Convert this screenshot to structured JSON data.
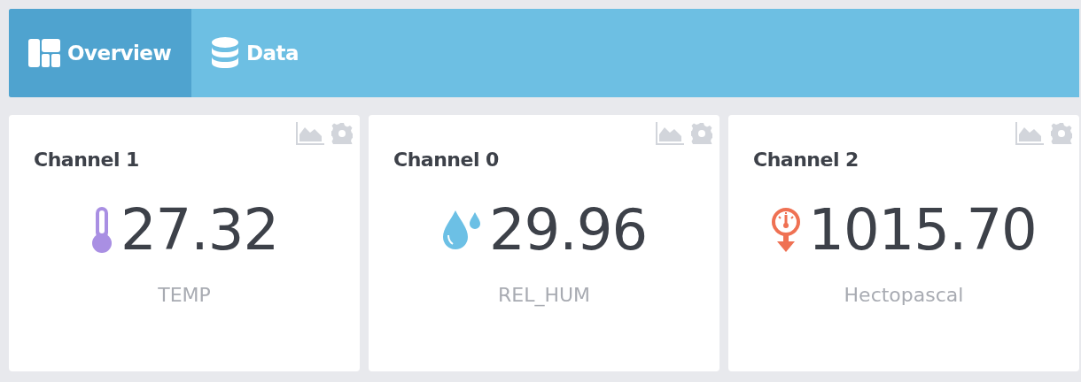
{
  "tabs": [
    {
      "label": "Overview",
      "kind": "overview",
      "selected": true
    },
    {
      "label": "Data",
      "kind": "data",
      "selected": false
    }
  ],
  "widgets": [
    {
      "title": "Channel 1",
      "kind": "thermometer",
      "color": "#a98fe3",
      "value": "27.32",
      "unit": "TEMP"
    },
    {
      "title": "Channel 0",
      "kind": "drop",
      "color": "#6cc0e5",
      "value": "29.96",
      "unit": "REL_HUM"
    },
    {
      "title": "Channel 2",
      "kind": "barometer",
      "color": "#ef7153",
      "value": "1015.70",
      "unit": "Hectopascal"
    }
  ]
}
